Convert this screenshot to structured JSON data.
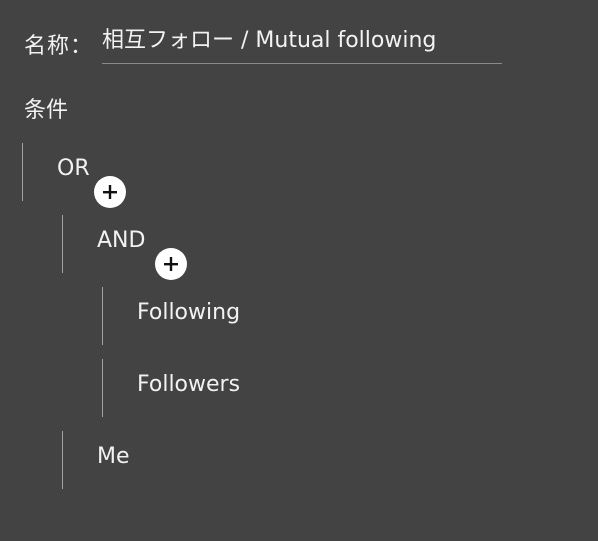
{
  "rule": {
    "name_label": "名称：",
    "name_value": "相互フォロー / Mutual following",
    "conditions_label": "条件"
  },
  "tree": {
    "or_label": "OR",
    "and_label": "AND",
    "following_label": "Following",
    "followers_label": "Followers",
    "me_label": "Me"
  },
  "icons": {
    "add": "plus-circle-icon"
  },
  "colors": {
    "background": "#434343",
    "text": "#f2f2f2",
    "bar": "#a0a0a0",
    "add_button": "#ffffff"
  }
}
